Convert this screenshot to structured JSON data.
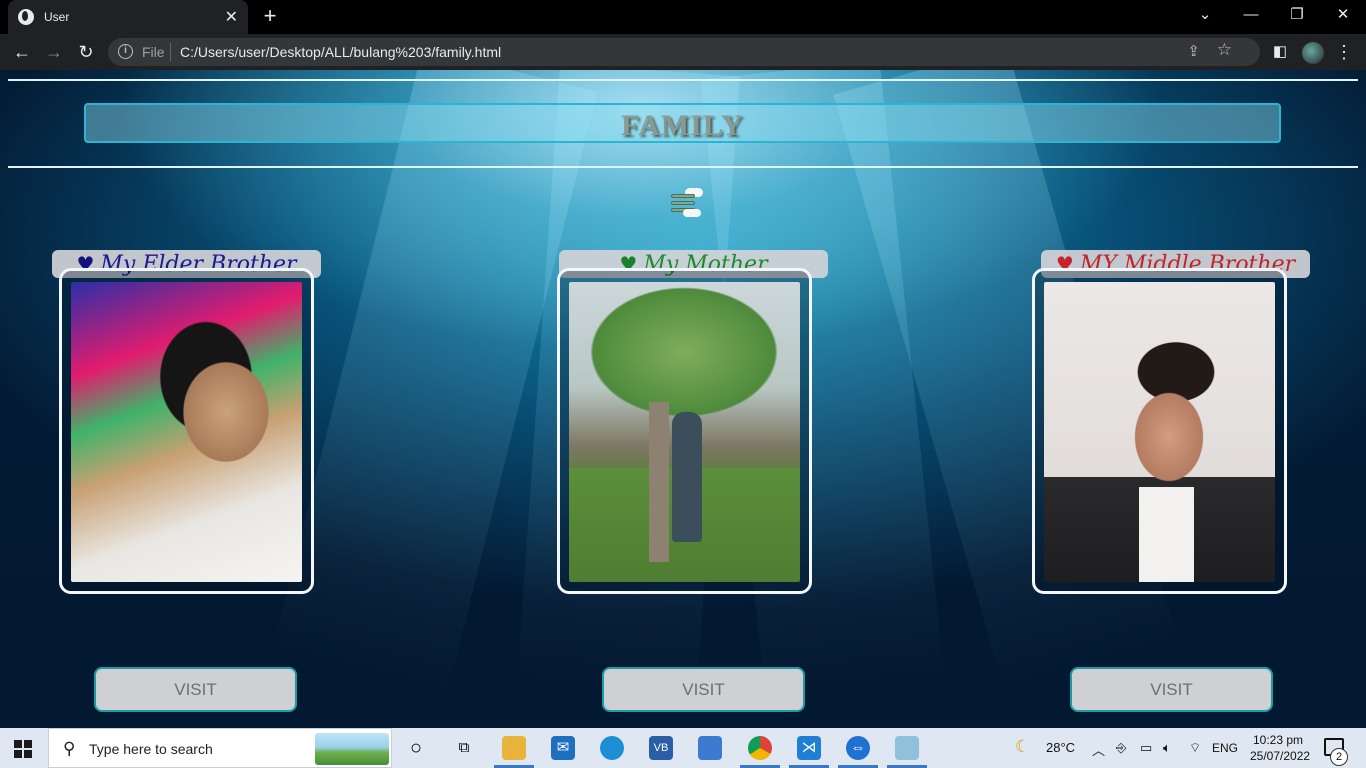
{
  "browser": {
    "tab_title": "User",
    "new_tab": "+",
    "close_tab": "✕",
    "address_scheme": "File",
    "address_url": "C:/Users/user/Desktop/ALL/bulang%203/family.html"
  },
  "page": {
    "heading": "FAMILY",
    "cards": [
      {
        "label": "My Elder Brother",
        "label_color": "#1a1a8c",
        "heart": "♥",
        "heart_color": "#12127a",
        "button": "VISIT"
      },
      {
        "label": "My Mother",
        "label_color": "#1f8a2c",
        "heart": "♥",
        "heart_color": "#17832a",
        "button": "VISIT"
      },
      {
        "label": "MY Middle Brother",
        "label_color": "#c0252a",
        "heart": "♥",
        "heart_color": "#c8232a",
        "button": "VISIT"
      }
    ]
  },
  "taskbar": {
    "search_placeholder": "Type here to search",
    "weather": "28°C",
    "language": "ENG",
    "time": "10:23 pm",
    "date": "25/07/2022",
    "notification_count": "2"
  },
  "icons": {
    "menu": "hamburger-cloud-icon",
    "heart": "heart-icon",
    "weather": "moon-cloud-icon"
  }
}
